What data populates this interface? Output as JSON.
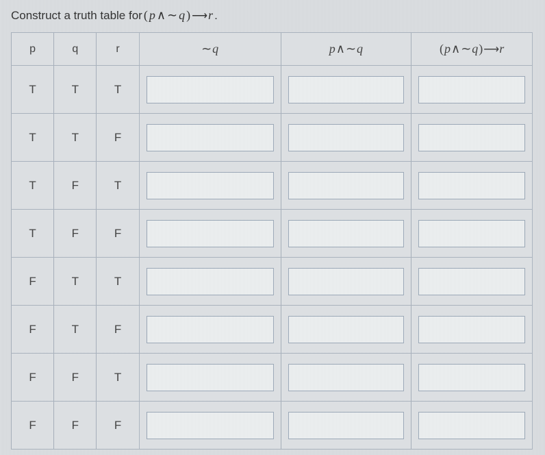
{
  "prompt": {
    "lead": "Construct a truth table for ",
    "expr_open": "(",
    "p": "p",
    "and": "∧",
    "tilde": "∼",
    "q": "q",
    "expr_close": ")",
    "arrow": "⟶",
    "r": "r",
    "period": "."
  },
  "headers": {
    "p": "p",
    "q": "q",
    "r": "r",
    "nq_tilde": "∼",
    "nq_q": "q",
    "pnq_p": "p",
    "pnq_and": "∧",
    "pnq_tilde": "∼",
    "pnq_q": "q",
    "impl_open": "(",
    "impl_p": "p",
    "impl_and": "∧",
    "impl_tilde": "∼",
    "impl_q": "q",
    "impl_close": ")",
    "impl_arrow": "⟶",
    "impl_r": "r"
  },
  "rows": [
    {
      "p": "T",
      "q": "T",
      "r": "T"
    },
    {
      "p": "T",
      "q": "T",
      "r": "F"
    },
    {
      "p": "T",
      "q": "F",
      "r": "T"
    },
    {
      "p": "T",
      "q": "F",
      "r": "F"
    },
    {
      "p": "F",
      "q": "T",
      "r": "T"
    },
    {
      "p": "F",
      "q": "T",
      "r": "F"
    },
    {
      "p": "F",
      "q": "F",
      "r": "T"
    },
    {
      "p": "F",
      "q": "F",
      "r": "F"
    }
  ]
}
